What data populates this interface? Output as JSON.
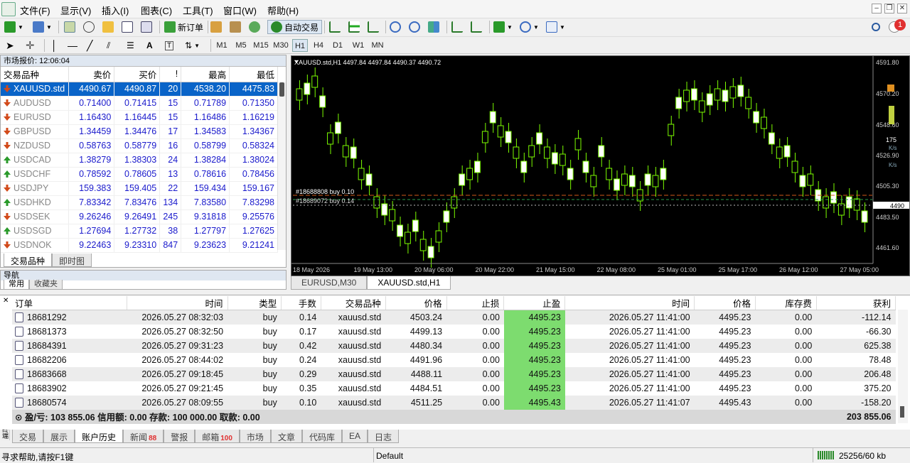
{
  "menu": [
    "文件(F)",
    "显示(V)",
    "插入(I)",
    "图表(C)",
    "工具(T)",
    "窗口(W)",
    "帮助(H)"
  ],
  "toolbar": {
    "new_order": "新订单",
    "auto_trade": "自动交易"
  },
  "timeframes": [
    "M1",
    "M5",
    "M15",
    "M30",
    "H1",
    "H4",
    "D1",
    "W1",
    "MN"
  ],
  "market_watch": {
    "title": "市场报价: 12:06:04",
    "columns": [
      "交易品种",
      "卖价",
      "买价",
      "!",
      "最高",
      "最低"
    ],
    "rows": [
      {
        "dir": "down",
        "symbol": "XAUUSD.std",
        "bid": "4490.67",
        "ask": "4490.87",
        "spread": "20",
        "high": "4538.20",
        "low": "4475.83"
      },
      {
        "dir": "down",
        "symbol": "AUDUSD",
        "bid": "0.71400",
        "ask": "0.71415",
        "spread": "15",
        "high": "0.71789",
        "low": "0.71350"
      },
      {
        "dir": "down",
        "symbol": "EURUSD",
        "bid": "1.16430",
        "ask": "1.16445",
        "spread": "15",
        "high": "1.16486",
        "low": "1.16219"
      },
      {
        "dir": "down",
        "symbol": "GBPUSD",
        "bid": "1.34459",
        "ask": "1.34476",
        "spread": "17",
        "high": "1.34583",
        "low": "1.34367"
      },
      {
        "dir": "down",
        "symbol": "NZDUSD",
        "bid": "0.58763",
        "ask": "0.58779",
        "spread": "16",
        "high": "0.58799",
        "low": "0.58324"
      },
      {
        "dir": "up",
        "symbol": "USDCAD",
        "bid": "1.38279",
        "ask": "1.38303",
        "spread": "24",
        "high": "1.38284",
        "low": "1.38024"
      },
      {
        "dir": "up",
        "symbol": "USDCHF",
        "bid": "0.78592",
        "ask": "0.78605",
        "spread": "13",
        "high": "0.78616",
        "low": "0.78456"
      },
      {
        "dir": "down",
        "symbol": "USDJPY",
        "bid": "159.383",
        "ask": "159.405",
        "spread": "22",
        "high": "159.434",
        "low": "159.167"
      },
      {
        "dir": "up",
        "symbol": "USDHKD",
        "bid": "7.83342",
        "ask": "7.83476",
        "spread": "134",
        "high": "7.83580",
        "low": "7.83298"
      },
      {
        "dir": "down",
        "symbol": "USDSEK",
        "bid": "9.26246",
        "ask": "9.26491",
        "spread": "245",
        "high": "9.31818",
        "low": "9.25576"
      },
      {
        "dir": "up",
        "symbol": "USDSGD",
        "bid": "1.27694",
        "ask": "1.27732",
        "spread": "38",
        "high": "1.27797",
        "low": "1.27625"
      },
      {
        "dir": "down",
        "symbol": "USDNOK",
        "bid": "9.22463",
        "ask": "9.23310",
        "spread": "847",
        "high": "9.23623",
        "low": "9.21241"
      }
    ],
    "tabs": [
      "交易品种",
      "即时图"
    ]
  },
  "navigator": {
    "title": "导航",
    "tabs": [
      "常用",
      "收藏夹"
    ]
  },
  "chart": {
    "header": "XAUUSD.std,H1  4497.84 4497.84 4490.37 4490.72",
    "price_labels": [
      "4591.80",
      "4570.20",
      "4548.60",
      "4526.90",
      "4505.30",
      "4490",
      "4483.50",
      "4461.60"
    ],
    "time_labels": [
      "18 May 2026",
      "19 May 13:00",
      "20 May 06:00",
      "20 May 22:00",
      "21 May 15:00",
      "22 May 08:00",
      "25 May 01:00",
      "25 May 17:00",
      "26 May 12:00",
      "27 May 05:00"
    ],
    "order_labels": [
      "#18688808 buy 0.10",
      "#18689072 buy 0.14"
    ],
    "side_info": {
      "count": "175",
      "ks1": "K/s",
      "ks2": "K/s"
    },
    "tabs": [
      "EURUSD,M30",
      "XAUUSD.std,H1"
    ]
  },
  "orders": {
    "columns": [
      "订单",
      "时间",
      "类型",
      "手数",
      "交易品种",
      "价格",
      "止损",
      "止盈",
      "时间",
      "价格",
      "库存费",
      "获利"
    ],
    "rows": [
      {
        "id": "18681292",
        "open_time": "2026.05.27 08:32:03",
        "type": "buy",
        "lots": "0.14",
        "symbol": "xauusd.std",
        "open_price": "4503.24",
        "sl": "0.00",
        "tp": "4495.23",
        "close_time": "2026.05.27 11:41:00",
        "close_price": "4495.23",
        "swap": "0.00",
        "profit": "-112.14"
      },
      {
        "id": "18681373",
        "open_time": "2026.05.27 08:32:50",
        "type": "buy",
        "lots": "0.17",
        "symbol": "xauusd.std",
        "open_price": "4499.13",
        "sl": "0.00",
        "tp": "4495.23",
        "close_time": "2026.05.27 11:41:00",
        "close_price": "4495.23",
        "swap": "0.00",
        "profit": "-66.30"
      },
      {
        "id": "18684391",
        "open_time": "2026.05.27 09:31:23",
        "type": "buy",
        "lots": "0.42",
        "symbol": "xauusd.std",
        "open_price": "4480.34",
        "sl": "0.00",
        "tp": "4495.23",
        "close_time": "2026.05.27 11:41:00",
        "close_price": "4495.23",
        "swap": "0.00",
        "profit": "625.38"
      },
      {
        "id": "18682206",
        "open_time": "2026.05.27 08:44:02",
        "type": "buy",
        "lots": "0.24",
        "symbol": "xauusd.std",
        "open_price": "4491.96",
        "sl": "0.00",
        "tp": "4495.23",
        "close_time": "2026.05.27 11:41:00",
        "close_price": "4495.23",
        "swap": "0.00",
        "profit": "78.48"
      },
      {
        "id": "18683668",
        "open_time": "2026.05.27 09:18:45",
        "type": "buy",
        "lots": "0.29",
        "symbol": "xauusd.std",
        "open_price": "4488.11",
        "sl": "0.00",
        "tp": "4495.23",
        "close_time": "2026.05.27 11:41:00",
        "close_price": "4495.23",
        "swap": "0.00",
        "profit": "206.48"
      },
      {
        "id": "18683902",
        "open_time": "2026.05.27 09:21:45",
        "type": "buy",
        "lots": "0.35",
        "symbol": "xauusd.std",
        "open_price": "4484.51",
        "sl": "0.00",
        "tp": "4495.23",
        "close_time": "2026.05.27 11:41:00",
        "close_price": "4495.23",
        "swap": "0.00",
        "profit": "375.20"
      },
      {
        "id": "18680574",
        "open_time": "2026.05.27 08:09:55",
        "type": "buy",
        "lots": "0.10",
        "symbol": "xauusd.std",
        "open_price": "4511.25",
        "sl": "0.00",
        "tp": "4495.43",
        "close_time": "2026.05.27 11:41:07",
        "close_price": "4495.43",
        "swap": "0.00",
        "profit": "-158.20"
      }
    ],
    "summary": "盈/亏: 103 855.06  信用额: 0.00  存款: 100 000.00  取款: 0.00",
    "summary_total": "203 855.06"
  },
  "bottom_tabs": [
    {
      "label": "交易",
      "badge": ""
    },
    {
      "label": "展示",
      "badge": ""
    },
    {
      "label": "账户历史",
      "badge": ""
    },
    {
      "label": "新闻",
      "badge": "88"
    },
    {
      "label": "警报",
      "badge": ""
    },
    {
      "label": "邮箱",
      "badge": "100"
    },
    {
      "label": "市场",
      "badge": ""
    },
    {
      "label": "文章",
      "badge": ""
    },
    {
      "label": "代码库",
      "badge": ""
    },
    {
      "label": "EA",
      "badge": ""
    },
    {
      "label": "日志",
      "badge": ""
    }
  ],
  "side_label": "终端",
  "status": {
    "help": "寻求帮助,请按F1键",
    "profile": "Default",
    "traffic": "25256/60 kb"
  },
  "notification_badge": "1",
  "colors": {
    "bull": "#7CFC00",
    "bg": "#000000",
    "selection": "#0a64c8",
    "tp_cell": "#7ddc6f",
    "badge": "#e03030"
  }
}
